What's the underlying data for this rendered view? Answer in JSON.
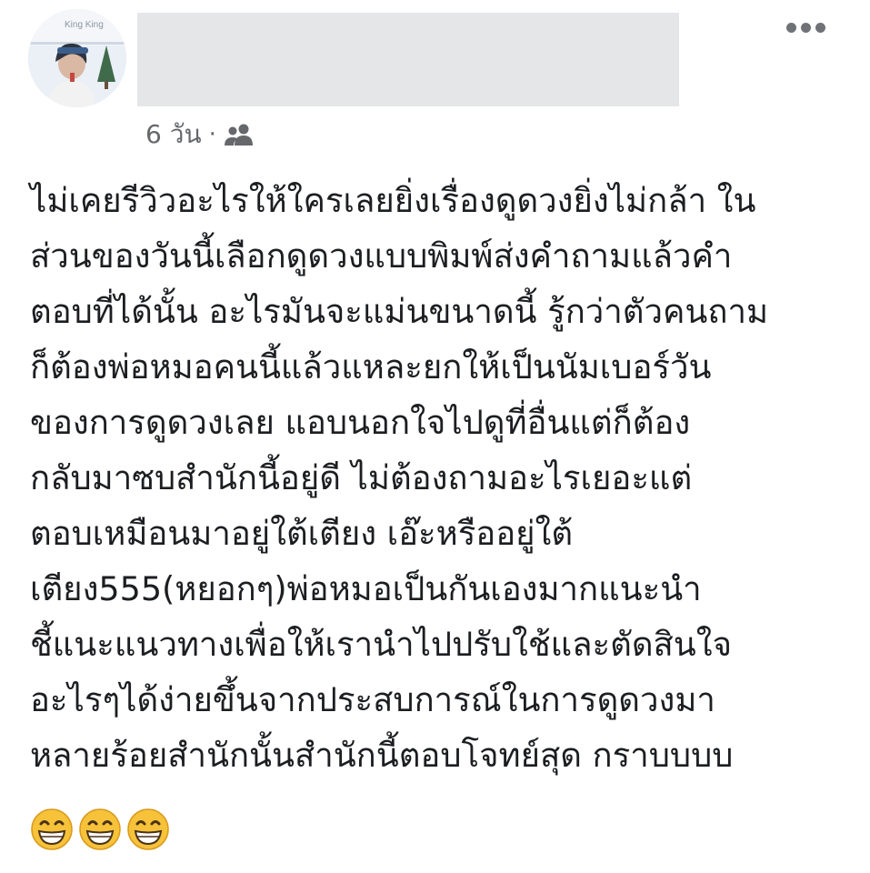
{
  "post": {
    "timestamp": "6 วัน",
    "separator": "·",
    "audience_icon": "friends-icon",
    "author_name_redacted": true,
    "more_icon": "more-horizontal-icon",
    "avatar_label": "King King",
    "body_lines": [
      "ไม่เคยรีวิวอะไรให้ใครเลยยิ่งเรื่องดูดวงยิ่งไม่กล้า ใน",
      "ส่วนของวันนี้เลือกดูดวงแบบพิมพ์ส่งคำถามแล้วคำ",
      "ตอบที่ได้นั้น อะไรมันจะแม่นขนาดนี้ รู้กว่าตัวคนถาม",
      "ก็ต้องพ่อหมอคนนี้แล้วแหละยกให้เป็นนัมเบอร์วัน",
      "ของการดูดวงเลย แอบนอกใจไปดูที่อื่นแต่ก็ต้อง",
      "กลับมาซบสำนักนี้อยู่ดี ไม่ต้องถามอะไรเยอะแต่",
      "ตอบเหมือนมาอยู่ใต้เตียง เอ๊ะหรืออยู่ใต้",
      "เตียง555(หยอกๆ)พ่อหมอเป็นกันเองมากแนะนำ",
      "ชี้แนะแนวทางเพื่อให้เรานำไปปรับใช้และตัดสินใจ",
      "อะไรๆได้ง่ายขึ้นจากประสบการณ์ในการดูดวงมา",
      "หลายร้อยสำนักนั้นสำนักนี้ตอบโจทย์สุด กราบบบบ"
    ],
    "emojis": [
      "grinning-face-icon",
      "grinning-face-icon",
      "grinning-face-icon"
    ],
    "colors": {
      "meta_text": "#65676b",
      "body_text": "#1c1e21",
      "redaction": "#e4e6e8",
      "emoji_face": "#f6c23a"
    }
  }
}
